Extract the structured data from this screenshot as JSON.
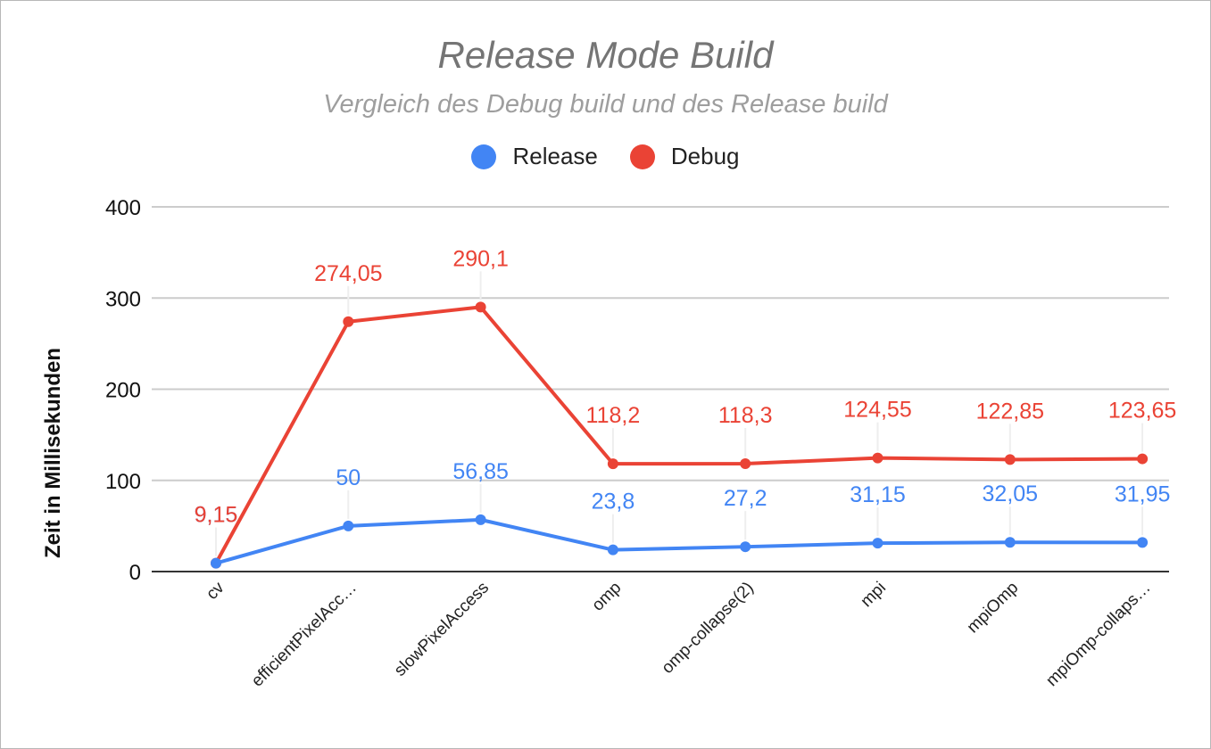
{
  "chart_data": {
    "type": "line",
    "title": "Release Mode Build",
    "subtitle": "Vergleich des Debug build und des Release build",
    "xlabel": "",
    "ylabel": "Zeit in Millisekunden",
    "categories": [
      "cv",
      "efficientPixelAcc…",
      "slowPixelAccess",
      "omp",
      "omp-collapse(2)",
      "mpi",
      "mpiOmp",
      "mpiOmp-collaps…"
    ],
    "series": [
      {
        "name": "Release",
        "color": "#4285f4",
        "values": [
          9.15,
          50,
          56.85,
          23.8,
          27.2,
          31.15,
          32.05,
          31.95
        ],
        "labels": [
          "9,15",
          "50",
          "56,85",
          "23,8",
          "27,2",
          "31,15",
          "32,05",
          "31,95"
        ]
      },
      {
        "name": "Debug",
        "color": "#ea4335",
        "values": [
          9.15,
          274.05,
          290.1,
          118.2,
          118.3,
          124.55,
          122.85,
          123.65
        ],
        "labels": [
          "9,15",
          "274,05",
          "290,1",
          "118,2",
          "118,3",
          "124,55",
          "122,85",
          "123,65"
        ]
      }
    ],
    "ylim": [
      0,
      400
    ],
    "yticks": [
      "0",
      "100",
      "200",
      "300",
      "400"
    ],
    "ytick_values": [
      0,
      100,
      200,
      300,
      400
    ],
    "grid": true,
    "legend": "top-center"
  }
}
